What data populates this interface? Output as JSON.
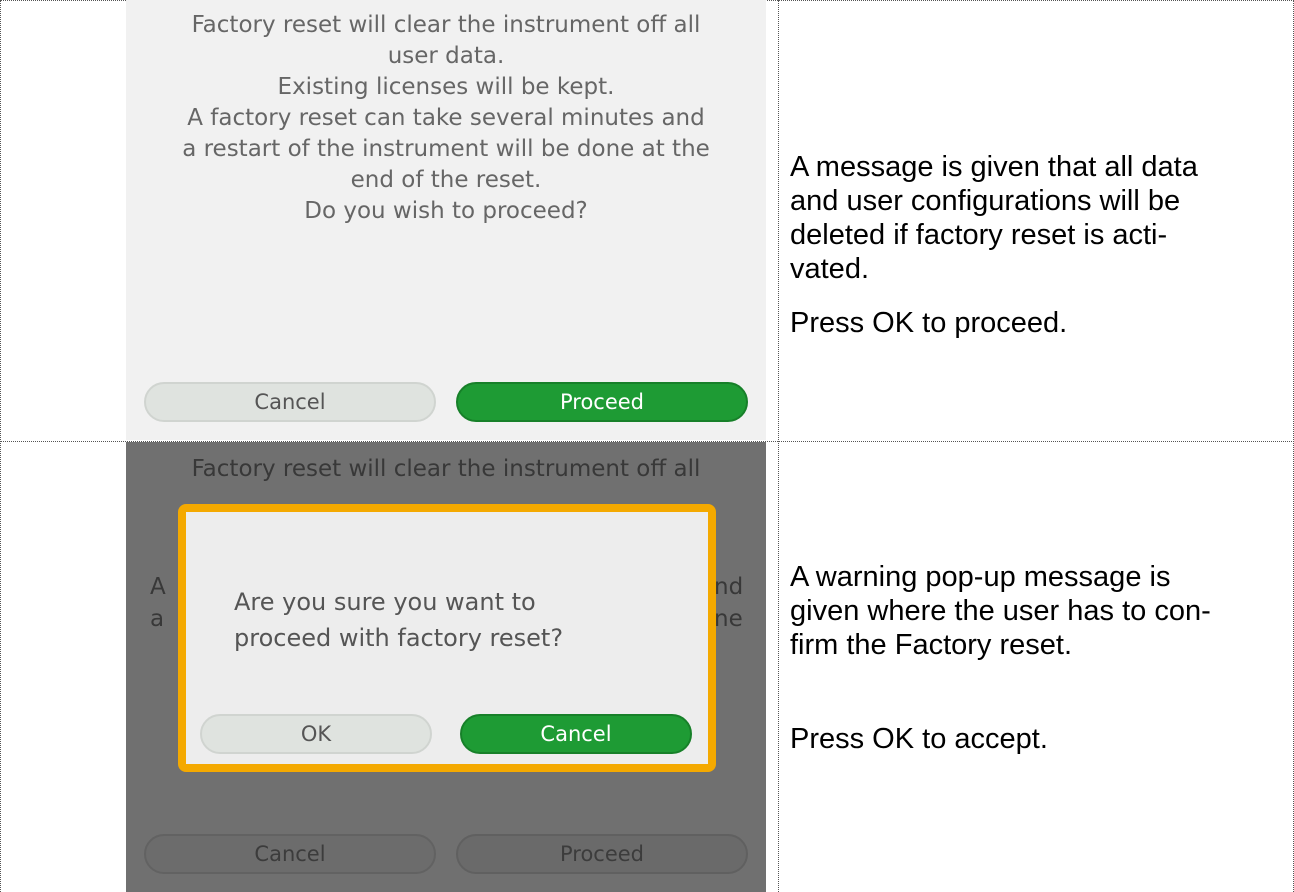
{
  "row1": {
    "screen": {
      "message_lines": [
        "Factory reset will clear the instrument off all",
        "user data.",
        "Existing licenses will be kept.",
        "A factory reset can take several minutes and",
        "a restart of the instrument will be done at the",
        "end of the reset.",
        "Do you wish to proceed?"
      ],
      "cancel_label": "Cancel",
      "proceed_label": "Proceed"
    },
    "description": {
      "paragraph1_lines": [
        "A message is given that all data",
        "and user configurations will be",
        "deleted if factory reset is acti-",
        "vated."
      ],
      "paragraph2": "Press OK to proceed."
    }
  },
  "row2": {
    "screen": {
      "background_lines": [
        "Factory reset will clear the instrument off all",
        "A",
        "nd",
        "a",
        "ne"
      ],
      "dialog": {
        "question_lines": [
          "Are you sure you want to",
          "proceed with factory reset?"
        ],
        "ok_label": "OK",
        "cancel_label": "Cancel"
      },
      "cancel_label": "Cancel",
      "proceed_label": "Proceed"
    },
    "description": {
      "paragraph1_lines": [
        "A warning pop-up message is",
        "given where the user has to con-",
        "firm the Factory reset."
      ],
      "paragraph2": "Press OK to accept."
    }
  },
  "colors": {
    "accent_green": "#1e9b34",
    "warning_border": "#f4a900",
    "screen_background": "#f1f1f1",
    "overlay_dim": "#707070"
  }
}
